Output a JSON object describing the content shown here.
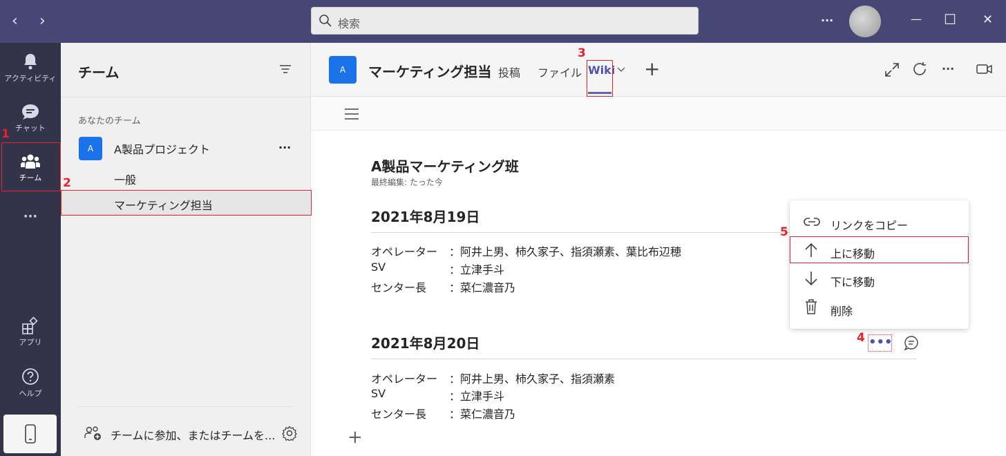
{
  "titlebar": {
    "back_glyph": "‹",
    "forward_glyph": "›",
    "search_placeholder": "検索",
    "more_glyph": "···",
    "minimize_glyph": "—",
    "maximize_glyph": "☐",
    "close_glyph": "✕"
  },
  "rail": {
    "items": [
      {
        "label": "アクティビティ",
        "icon": "bell-icon"
      },
      {
        "label": "チャット",
        "icon": "chat-icon"
      },
      {
        "label": "チーム",
        "icon": "teams-icon"
      },
      {
        "label": "···",
        "icon": "more-apps-icon"
      },
      {
        "label": "アプリ",
        "icon": "apps-icon"
      },
      {
        "label": "ヘルプ",
        "icon": "help-icon"
      }
    ]
  },
  "sidebar": {
    "title": "チーム",
    "section_label": "あなたのチーム",
    "team": {
      "avatar": "A",
      "name": "A製品プロジェクト",
      "more": "···"
    },
    "channels": [
      "一般",
      "マーケティング担当"
    ],
    "join_label": "チームに参加、またはチームを..."
  },
  "header": {
    "avatar": "A",
    "channel_name": "マーケティング担当",
    "tabs": [
      "投稿",
      "ファイル",
      "Wiki"
    ],
    "add_tab": "+",
    "more": "···"
  },
  "wiki": {
    "page_title": "A製品マーケティング班",
    "last_edited": "最終編集: たった今",
    "sections": [
      {
        "heading": "2021年8月19日",
        "rows": [
          {
            "key": "オペレーター",
            "value": "：阿井上男、柿久家子、指須瀬素、葉比布辺穂"
          },
          {
            "key": "SV",
            "value": "：立津手斗"
          },
          {
            "key": "センター長",
            "value": "：菜仁濃音乃"
          }
        ]
      },
      {
        "heading": "2021年8月20日",
        "rows": [
          {
            "key": "オペレーター",
            "value": "：阿井上男、柿久家子、指須瀬素"
          },
          {
            "key": "SV",
            "value": "：立津手斗"
          },
          {
            "key": "センター長",
            "value": "：菜仁濃音乃"
          }
        ]
      }
    ],
    "section_more": "•••",
    "add_section": "+"
  },
  "context_menu": {
    "items": [
      {
        "label": "リンクをコピー",
        "icon": "link-icon"
      },
      {
        "label": "上に移動",
        "icon": "arrow-up-icon"
      },
      {
        "label": "下に移動",
        "icon": "arrow-down-icon"
      },
      {
        "label": "削除",
        "icon": "trash-icon"
      }
    ]
  },
  "annotations": [
    "1",
    "2",
    "3",
    "4",
    "5"
  ],
  "colors": {
    "accent": "#6264a7",
    "titlebar": "#464775",
    "rail": "#33344a",
    "annotation_red": "#e8222b",
    "team_avatar": "#1a73e8"
  }
}
